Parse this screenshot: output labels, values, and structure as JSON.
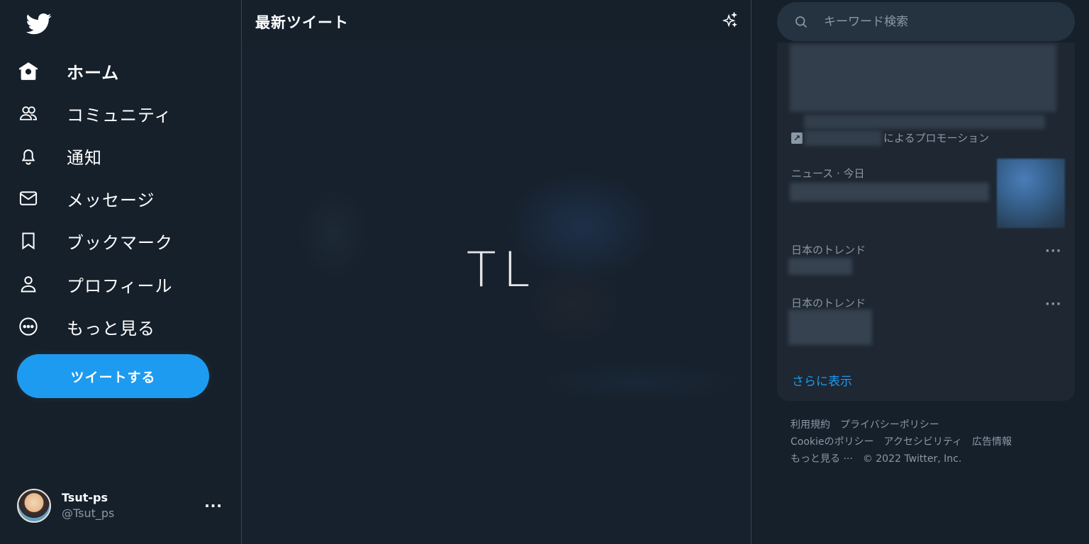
{
  "sidebar": {
    "logo": "twitter-bird-icon",
    "nav": [
      {
        "label": "ホーム",
        "icon": "home-icon",
        "active": true
      },
      {
        "label": "コミュニティ",
        "icon": "communities-icon"
      },
      {
        "label": "通知",
        "icon": "bell-icon"
      },
      {
        "label": "メッセージ",
        "icon": "envelope-icon"
      },
      {
        "label": "ブックマーク",
        "icon": "bookmark-icon"
      },
      {
        "label": "プロフィール",
        "icon": "profile-icon"
      },
      {
        "label": "もっと見る",
        "icon": "more-circle-icon"
      }
    ],
    "tweet_button": "ツイートする",
    "account": {
      "name": "Tsut-ps",
      "handle": "@Tsut_ps",
      "more": "···"
    }
  },
  "center": {
    "title": "最新ツイート",
    "placeholder_text": "TL"
  },
  "right": {
    "search": {
      "placeholder": "キーワード検索"
    },
    "promo_text": "によるプロモーション",
    "news_meta": "ニュース · 今日",
    "trends": [
      {
        "meta": "日本のトレンド",
        "more": "···"
      },
      {
        "meta": "日本のトレンド",
        "more": "···"
      }
    ],
    "show_more": "さらに表示",
    "footer": {
      "row1": [
        "利用規約",
        "プライバシーポリシー"
      ],
      "row2": [
        "Cookieのポリシー",
        "アクセシビリティ",
        "広告情報"
      ],
      "row3": [
        "もっと見る ···",
        "© 2022 Twitter, Inc."
      ]
    }
  },
  "colors": {
    "background": "#15202b",
    "accent": "#1d9bf0",
    "panel": "#1e2732",
    "muted_text": "#8b98a5",
    "divider": "#38444d"
  }
}
